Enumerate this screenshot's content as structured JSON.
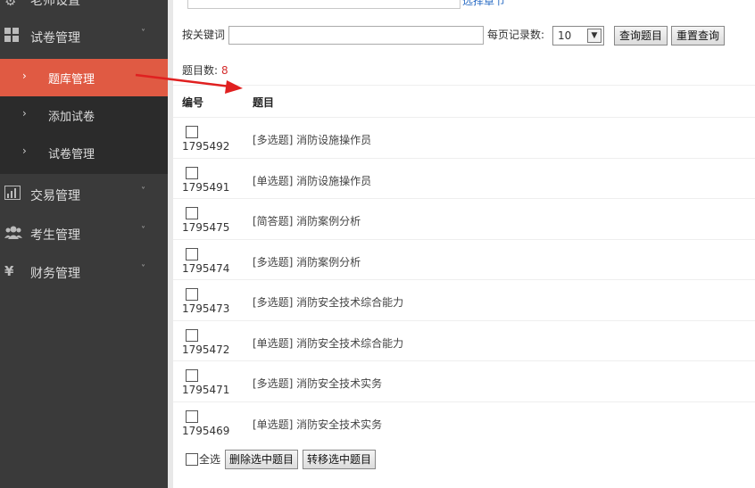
{
  "sidebar": {
    "top_item": {
      "label": "老师设置",
      "icon": "settings-icon"
    },
    "items": [
      {
        "label": "试卷管理",
        "icon": "grid-icon"
      },
      {
        "label": "交易管理",
        "icon": "chart-icon"
      },
      {
        "label": "考生管理",
        "icon": "users-icon"
      },
      {
        "label": "财务管理",
        "icon": "yen-icon"
      }
    ],
    "sub_items": [
      {
        "label": "题库管理",
        "active": true
      },
      {
        "label": "添加试卷",
        "active": false
      },
      {
        "label": "试卷管理",
        "active": false
      }
    ],
    "colors": {
      "bg": "#3a3a3a",
      "active": "#e05a43"
    }
  },
  "top": {
    "link": "选择章节"
  },
  "filter": {
    "keyword_label": "按关键词",
    "keyword_value": "",
    "page_size_label": "每页记录数:",
    "page_size_value": "10",
    "query_button": "查询题目",
    "reset_button": "重置查询"
  },
  "summary": {
    "label": "题目数:",
    "count": "8"
  },
  "table": {
    "headers": {
      "id": "编号",
      "title": "题目"
    },
    "rows": [
      {
        "id": "1795492",
        "title": "[多选题] 消防设施操作员"
      },
      {
        "id": "1795491",
        "title": "[单选题] 消防设施操作员"
      },
      {
        "id": "1795475",
        "title": "[简答题] 消防案例分析"
      },
      {
        "id": "1795474",
        "title": "[多选题] 消防案例分析"
      },
      {
        "id": "1795473",
        "title": "[多选题] 消防安全技术综合能力"
      },
      {
        "id": "1795472",
        "title": "[单选题] 消防安全技术综合能力"
      },
      {
        "id": "1795471",
        "title": "[多选题] 消防安全技术实务"
      },
      {
        "id": "1795469",
        "title": "[单选题] 消防安全技术实务"
      }
    ]
  },
  "footer": {
    "select_all": "全选",
    "delete_button": "删除选中题目",
    "move_button": "转移选中题目"
  }
}
